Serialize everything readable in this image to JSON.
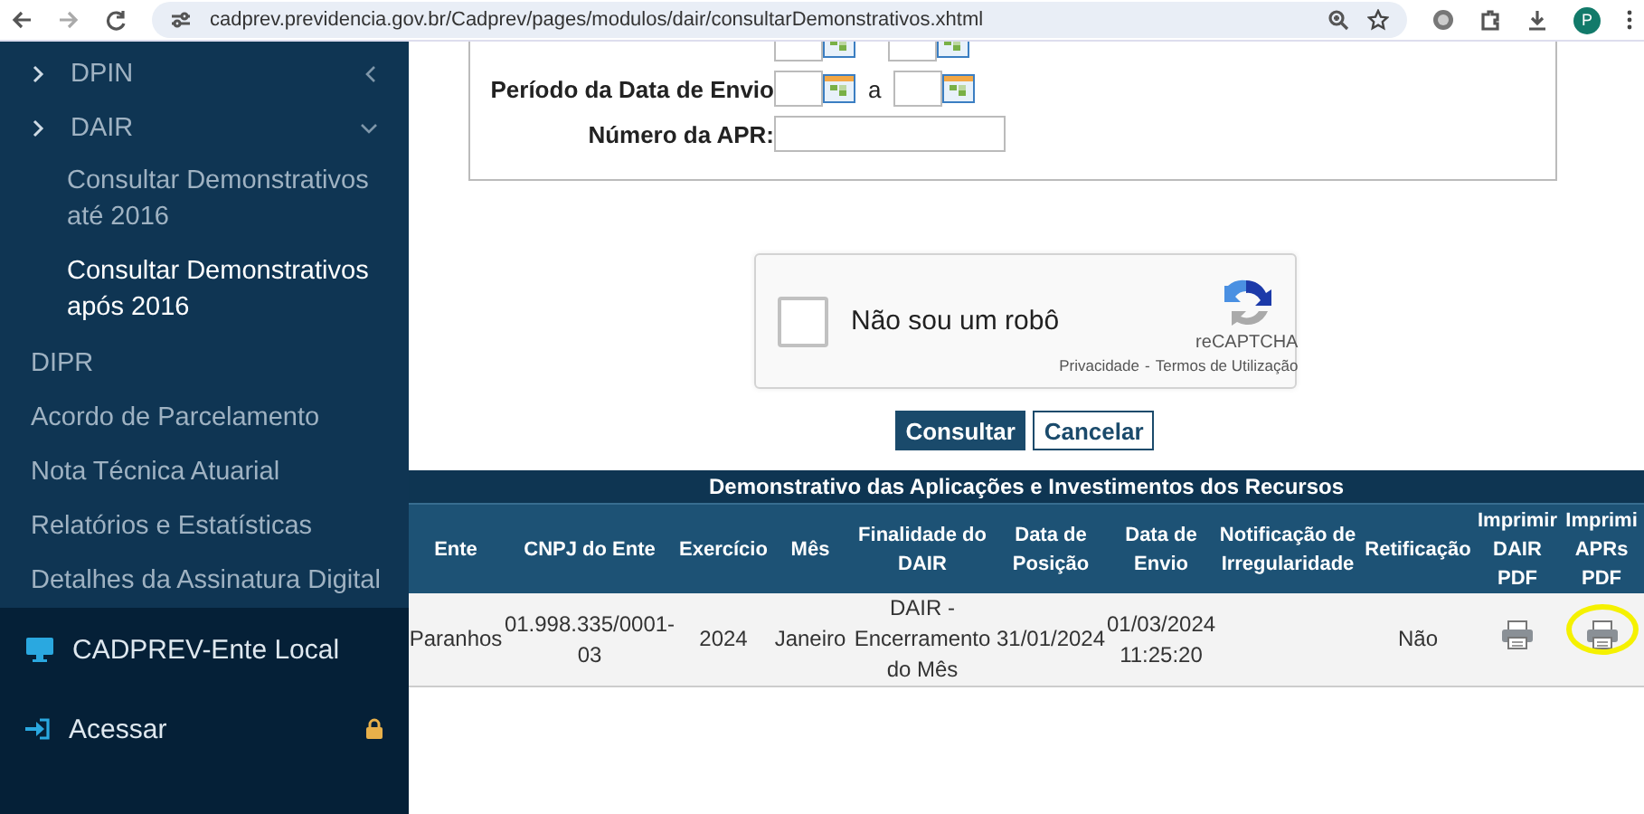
{
  "browser": {
    "url": "cadprev.previdencia.gov.br/Cadprev/pages/modulos/dair/consultarDemonstrativos.xhtml",
    "profile_initial": "P"
  },
  "sidebar": {
    "items": [
      {
        "label": "DPIN",
        "expanded": false,
        "selected": false
      },
      {
        "label": "DAIR",
        "expanded": true,
        "selected": false,
        "children": [
          {
            "label": "Consultar Demonstrativos até 2016",
            "selected": false
          },
          {
            "label": "Consultar Demonstrativos após 2016",
            "selected": true
          }
        ]
      },
      {
        "label": "DIPR",
        "selected": false
      },
      {
        "label": "Acordo de Parcelamento",
        "selected": false
      },
      {
        "label": "Nota Técnica Atuarial",
        "selected": false
      },
      {
        "label": "Relatórios e Estatísticas",
        "selected": false
      },
      {
        "label": "Detalhes da Assinatura Digital",
        "selected": false
      }
    ],
    "app_title": "CADPREV-Ente Local",
    "login": {
      "label": "Acessar",
      "locked": true
    }
  },
  "form": {
    "fields": [
      {
        "kind": "date-range"
      },
      {
        "kind": "date-range",
        "label": "Período da Data de Envio",
        "separator": "a"
      },
      {
        "kind": "text",
        "label": "Número da APR:"
      }
    ]
  },
  "captcha": {
    "checked": false,
    "label": "Não sou um robô",
    "brand": "reCAPTCHA",
    "links": [
      "Privacidade",
      "Termos de Utilização"
    ],
    "separator": "-"
  },
  "buttons": [
    {
      "label": "Consultar",
      "kind": "primary"
    },
    {
      "label": "Cancelar",
      "kind": "secondary"
    }
  ],
  "table": {
    "title": "Demonstrativo das Aplicações e Investimentos dos Recursos",
    "columns": [
      "Ente",
      "CNPJ do Ente",
      "Exercício",
      "Mês",
      "Finalidade do DAIR",
      "Data de Posição",
      "Data de Envio",
      "Notificação de Irregularidade",
      "Retificação",
      "Imprimir DAIR PDF",
      "Imprimi APRs PDF"
    ],
    "rows": [
      {
        "cells": [
          {
            "kind": "text",
            "text": "Paranhos"
          },
          {
            "kind": "text",
            "text": "01.998.335/0001-03"
          },
          {
            "kind": "text",
            "text": "2024"
          },
          {
            "kind": "text",
            "text": "Janeiro"
          },
          {
            "kind": "text",
            "text": "DAIR - Encerramento do Mês"
          },
          {
            "kind": "text",
            "text": "31/01/2024"
          },
          {
            "kind": "text",
            "text": "01/03/2024 11:25:20"
          },
          {
            "kind": "blank"
          },
          {
            "kind": "text",
            "text": "Não"
          },
          {
            "kind": "print",
            "highlighted": false
          },
          {
            "kind": "print",
            "highlighted": true
          }
        ]
      }
    ]
  }
}
